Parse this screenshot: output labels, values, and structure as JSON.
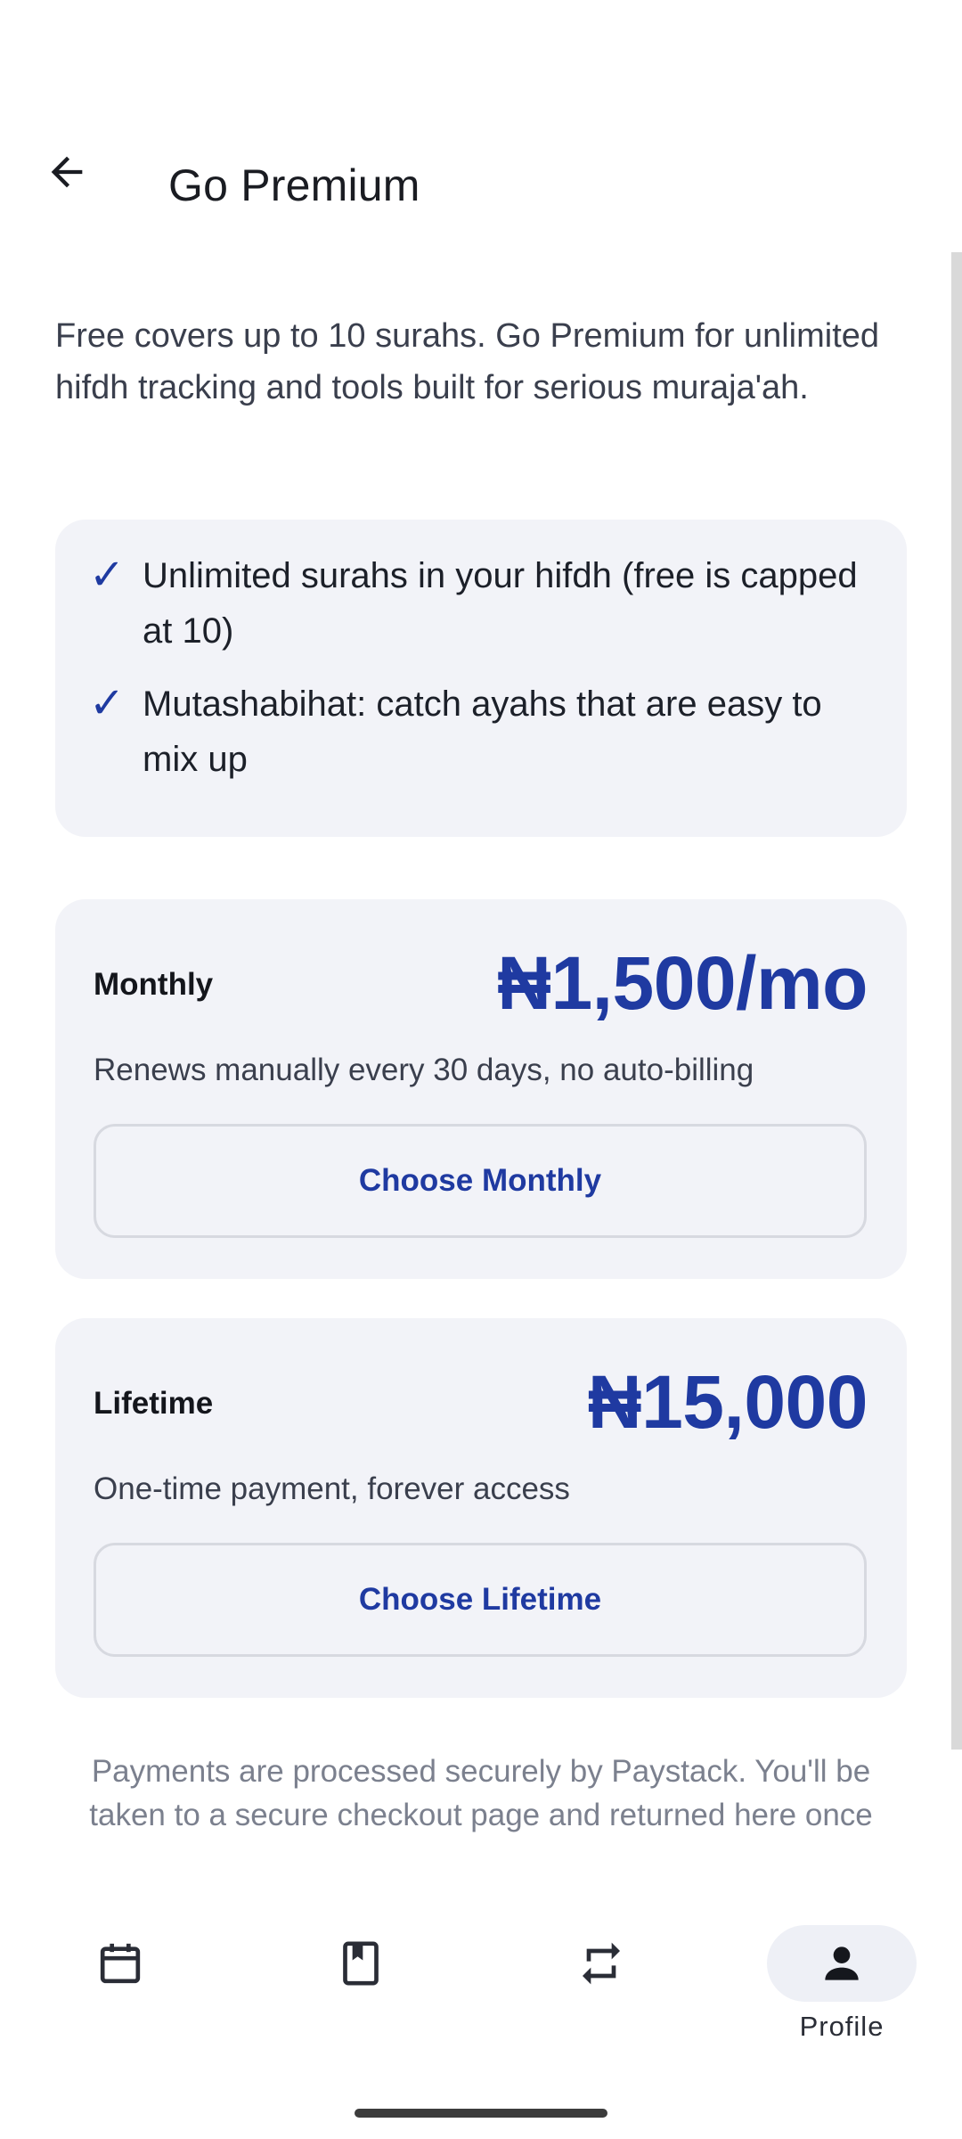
{
  "header": {
    "title": "Go Premium",
    "back_icon": "arrow-left-icon"
  },
  "intro": "Free covers up to 10 surahs. Go Premium for unlimited hifdh tracking and tools built for serious muraja'ah.",
  "features": [
    {
      "check": "✓",
      "text": "Unlimited surahs in your hifdh (free is capped at 10)"
    },
    {
      "check": "✓",
      "text": "Mutashabihat: catch ayahs that are easy to mix up"
    }
  ],
  "plans": [
    {
      "name": "Monthly",
      "price": "₦1,500/mo",
      "description": "Renews manually every 30 days, no auto-billing",
      "button_label": "Choose Monthly"
    },
    {
      "name": "Lifetime",
      "price": "₦15,000",
      "description": "One-time payment, forever access",
      "button_label": "Choose Lifetime"
    }
  ],
  "footnote": "Payments are processed securely by Paystack. You'll be taken to a secure checkout page and returned here once",
  "bottom_nav": {
    "items": [
      {
        "icon": "calendar-icon",
        "label": ""
      },
      {
        "icon": "bookmark-book-icon",
        "label": ""
      },
      {
        "icon": "repeat-icon",
        "label": ""
      },
      {
        "icon": "person-icon",
        "label": "Profile",
        "active": true
      }
    ]
  },
  "colors": {
    "accent": "#1f3aa1",
    "card_bg": "#f2f3f8",
    "text": "#1c2029",
    "muted": "#7b808e"
  }
}
